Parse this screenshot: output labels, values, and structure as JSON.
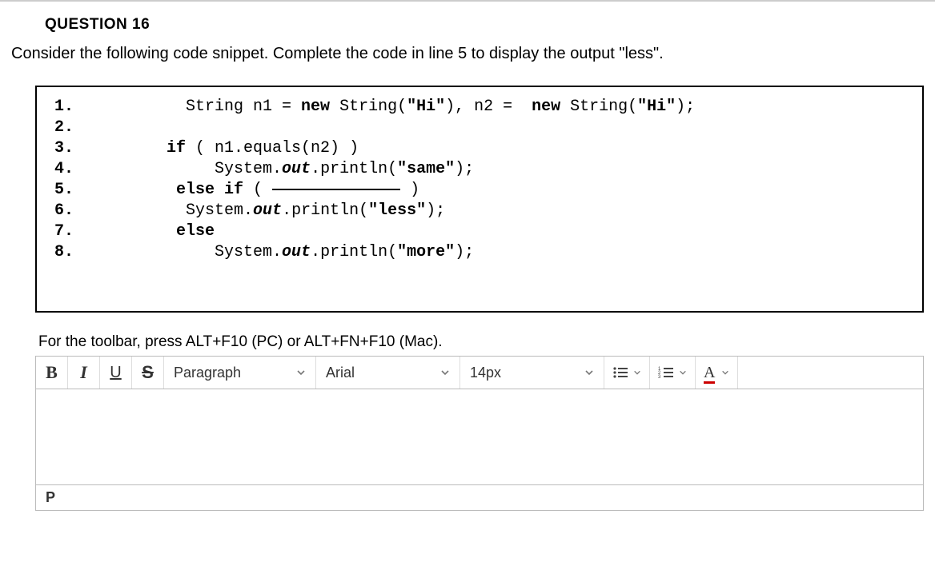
{
  "heading": "QUESTION 16",
  "prompt": "Consider the following code snippet. Complete the code in line 5 to display the output \"less\".",
  "code": {
    "lines": [
      "1.",
      "2.",
      "3.",
      "4.",
      "5.",
      "6.",
      "7.",
      "8."
    ],
    "l1": {
      "a": "          String n1 = ",
      "b": "new",
      "c": " String(",
      "d": "\"Hi\"",
      "e": "), n2 =  ",
      "f": "new",
      "g": " String(",
      "h": "\"Hi\"",
      "i": ");"
    },
    "l3": {
      "a": "        ",
      "b": "if",
      "c": " ( n1.equals(n2) )"
    },
    "l4": {
      "a": "             System.",
      "b": "out",
      "c": ".println(",
      "d": "\"same\"",
      "e": ");"
    },
    "l5": {
      "a": "         ",
      "b": "else if",
      "c": " ( ",
      "d": " )"
    },
    "l6": {
      "a": "          System.",
      "b": "out",
      "c": ".println(",
      "d": "\"less\"",
      "e": ");"
    },
    "l7": {
      "a": "         ",
      "b": "else"
    },
    "l8": {
      "a": "             System.",
      "b": "out",
      "c": ".println(",
      "d": "\"more\"",
      "e": ");"
    }
  },
  "toolbar": {
    "help": "For the toolbar, press ALT+F10 (PC) or ALT+FN+F10 (Mac).",
    "bold": "B",
    "italic": "I",
    "underline": "U",
    "strike": "S",
    "block": "Paragraph",
    "font": "Arial",
    "size": "14px",
    "textcolor": "A"
  },
  "status": "P"
}
